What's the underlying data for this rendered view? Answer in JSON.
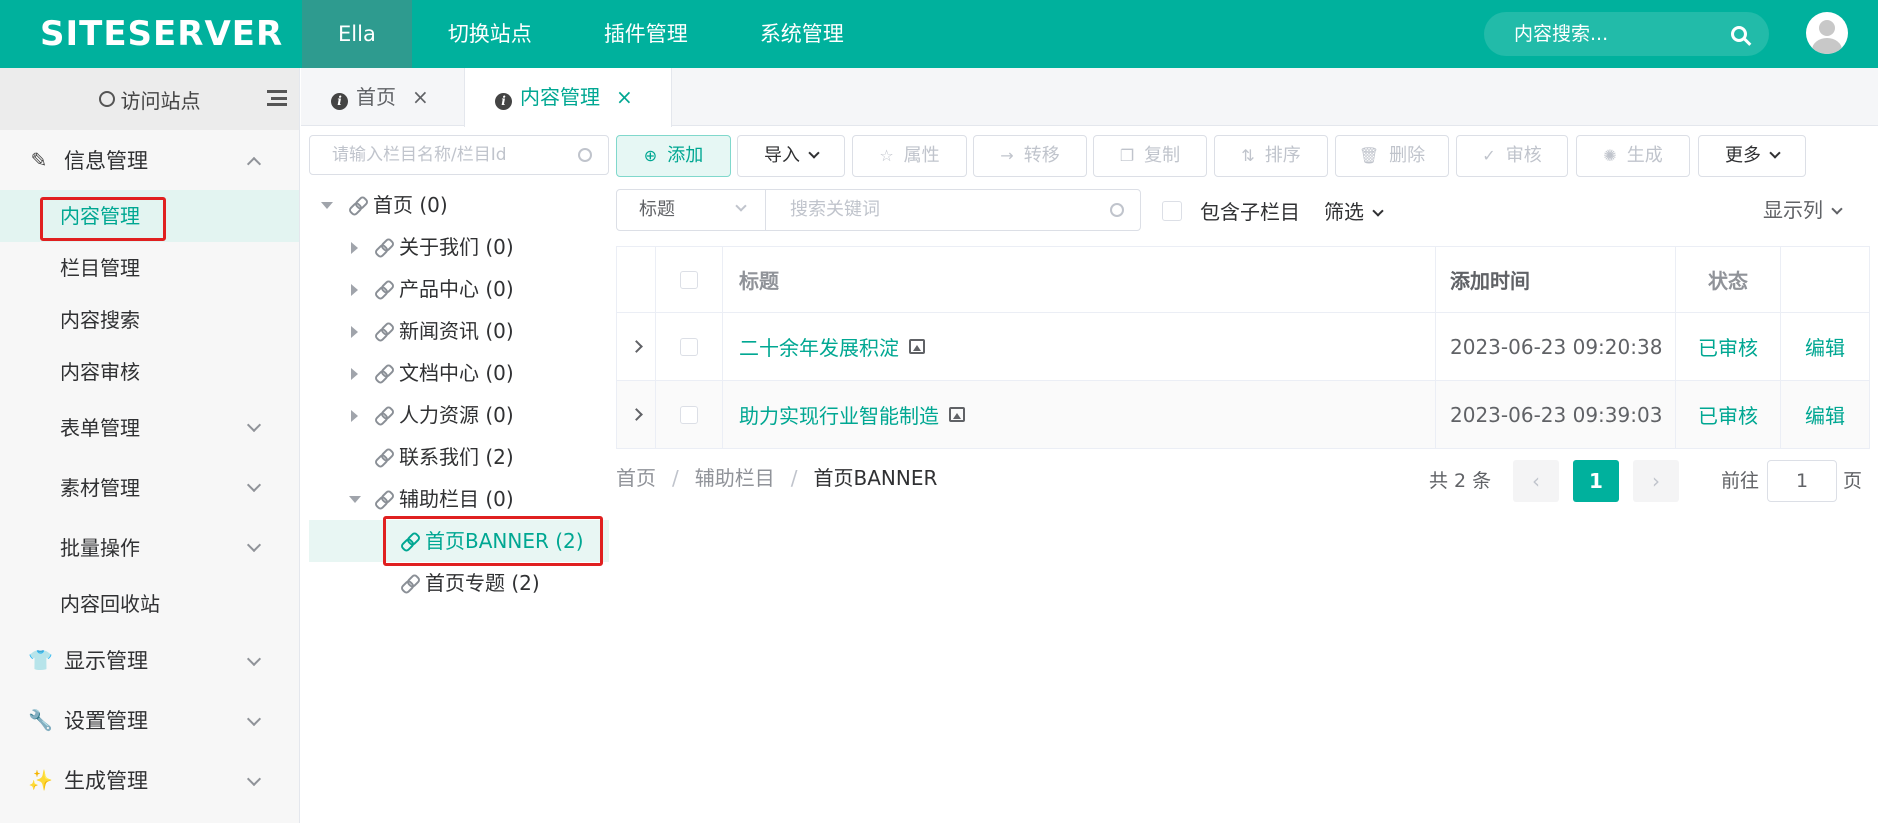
{
  "header": {
    "logo": "SITESERVER",
    "nav": [
      "Ella",
      "切换站点",
      "插件管理",
      "系统管理"
    ],
    "search_placeholder": "内容搜索..."
  },
  "sidebar": {
    "visit": "访问站点",
    "groups": {
      "info": "信息管理",
      "display": "显示管理",
      "settings": "设置管理",
      "generate": "生成管理"
    },
    "items": [
      "内容管理",
      "栏目管理",
      "内容搜索",
      "内容审核",
      "表单管理",
      "素材管理",
      "批量操作",
      "内容回收站"
    ]
  },
  "tabs": [
    "首页",
    "内容管理"
  ],
  "tree": {
    "search_placeholder": "请输入栏目名称/栏目Id",
    "nodes": [
      "首页 (0)",
      "关于我们 (0)",
      "产品中心 (0)",
      "新闻资讯 (0)",
      "文档中心 (0)",
      "人力资源 (0)",
      "联系我们 (2)",
      "辅助栏目 (0)",
      "首页BANNER (2)",
      "首页专题 (2)"
    ]
  },
  "toolbar": {
    "add": "添加",
    "import": "导入",
    "attr": "属性",
    "move": "转移",
    "copy": "复制",
    "sort": "排序",
    "delete": "删除",
    "audit": "审核",
    "generate": "生成",
    "more": "更多"
  },
  "filter": {
    "field": "标题",
    "keyword_placeholder": "搜索关键词",
    "include_children": "包含子栏目",
    "filter": "筛选",
    "columns": "显示列"
  },
  "table": {
    "headers": [
      "标题",
      "添加时间",
      "状态"
    ],
    "rows": [
      {
        "title": "二十余年发展积淀",
        "time": "2023-06-23 09:20:38",
        "status": "已审核",
        "action": "编辑"
      },
      {
        "title": "助力实现行业智能制造",
        "time": "2023-06-23 09:39:03",
        "status": "已审核",
        "action": "编辑"
      }
    ]
  },
  "breadcrumb": [
    "首页",
    "辅助栏目",
    "首页BANNER"
  ],
  "pagination": {
    "total": "共 2 条",
    "prev": "‹",
    "page": "1",
    "next": "›",
    "goto": "前往",
    "goto_value": "1",
    "page_unit": "页"
  }
}
